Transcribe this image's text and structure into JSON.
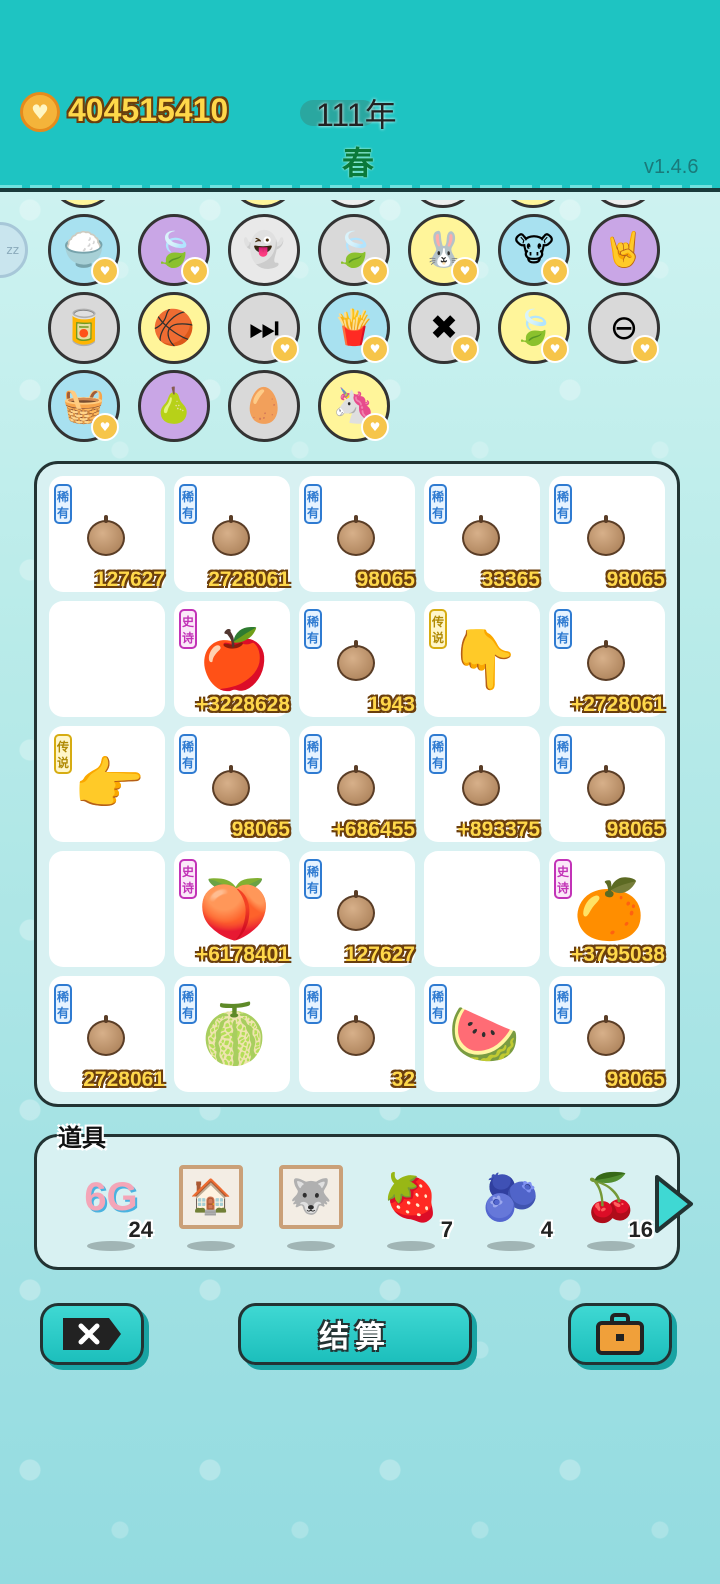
{
  "header": {
    "gold": "404515410",
    "year": "111年",
    "season": "春",
    "version": "v1.4.6",
    "side_button_label": "zz"
  },
  "symbols": [
    {
      "icon": "rice-bowl-icon",
      "glyph": "🍚",
      "bg": "#a8e1f0"
    },
    {
      "icon": "leaf-icon",
      "glyph": "🍃",
      "bg": "#c9a6e6"
    },
    {
      "icon": "ghost-icon",
      "glyph": "👻",
      "bg": "#e9e9e9"
    },
    {
      "icon": "leaf-icon",
      "glyph": "🍃",
      "bg": "#d9d9d9"
    },
    {
      "icon": "rabbit-icon",
      "glyph": "🐰",
      "bg": "#fff59a"
    },
    {
      "icon": "cows-icon",
      "glyph": "🐮",
      "bg": "#a8e1f0"
    },
    {
      "icon": "rock-hand-icon",
      "glyph": "🤘",
      "bg": "#c9a6e6"
    },
    {
      "icon": "dog-food-icon",
      "glyph": "🥫",
      "bg": "#d9d9d9"
    },
    {
      "icon": "basketballs-icon",
      "glyph": "🏀",
      "bg": "#fff59a"
    },
    {
      "icon": "skip-icon",
      "glyph": "⏭",
      "bg": "#d9d9d9"
    },
    {
      "icon": "fries-icon",
      "glyph": "🍟",
      "bg": "#a8e1f0"
    },
    {
      "icon": "remove-icon",
      "glyph": "✖",
      "bg": "#d9d9d9"
    },
    {
      "icon": "leaf-icon",
      "glyph": "🍃",
      "bg": "#fff59a"
    },
    {
      "icon": "minus-icon",
      "glyph": "⊖",
      "bg": "#d9d9d9"
    },
    {
      "icon": "fruit-basket-icon",
      "glyph": "🧺",
      "bg": "#a8e1f0"
    },
    {
      "icon": "pear-icon",
      "glyph": "🍐",
      "bg": "#c9a6e6"
    },
    {
      "icon": "egg-tray-icon",
      "glyph": "🥚",
      "bg": "#d9d9d9"
    },
    {
      "icon": "unicorn-icon",
      "glyph": "🦄",
      "bg": "#fff59a"
    }
  ],
  "board": [
    {
      "tag": "稀有",
      "tag_type": "rare",
      "icon": "nut",
      "value": "127627"
    },
    {
      "tag": "稀有",
      "tag_type": "rare",
      "icon": "nut",
      "value": "2728061"
    },
    {
      "tag": "稀有",
      "tag_type": "rare",
      "icon": "nut",
      "value": "98065"
    },
    {
      "tag": "稀有",
      "tag_type": "rare",
      "icon": "nut",
      "value": "33365"
    },
    {
      "tag": "稀有",
      "tag_type": "rare",
      "icon": "nut",
      "value": "98065"
    },
    {
      "tag": "",
      "tag_type": "",
      "icon": "",
      "value": ""
    },
    {
      "tag": "史诗",
      "tag_type": "epic",
      "icon": "🍎",
      "icon_name": "apple-icon",
      "value": "+3228628"
    },
    {
      "tag": "稀有",
      "tag_type": "rare",
      "icon": "nut",
      "value": "1943"
    },
    {
      "tag": "传说",
      "tag_type": "legend",
      "icon": "👇",
      "icon_name": "pointing-hand-icon",
      "value": ""
    },
    {
      "tag": "稀有",
      "tag_type": "rare",
      "icon": "nut",
      "value": "+2728061"
    },
    {
      "tag": "传说",
      "tag_type": "legend",
      "icon": "👉",
      "icon_name": "pointing-hand-icon",
      "value": ""
    },
    {
      "tag": "稀有",
      "tag_type": "rare",
      "icon": "nut",
      "value": "98065"
    },
    {
      "tag": "稀有",
      "tag_type": "rare",
      "icon": "nut",
      "value": "+686455"
    },
    {
      "tag": "稀有",
      "tag_type": "rare",
      "icon": "nut",
      "value": "+893375"
    },
    {
      "tag": "稀有",
      "tag_type": "rare",
      "icon": "nut",
      "value": "98065"
    },
    {
      "tag": "",
      "tag_type": "",
      "icon": "",
      "value": ""
    },
    {
      "tag": "史诗",
      "tag_type": "epic",
      "icon": "🍑",
      "icon_name": "peach-icon",
      "value": "+6178401"
    },
    {
      "tag": "稀有",
      "tag_type": "rare",
      "icon": "nut",
      "value": "127627"
    },
    {
      "tag": "",
      "tag_type": "",
      "icon": "",
      "value": ""
    },
    {
      "tag": "史诗",
      "tag_type": "epic",
      "icon": "🍊",
      "icon_name": "orange-icon",
      "value": "+3795038"
    },
    {
      "tag": "稀有",
      "tag_type": "rare",
      "icon": "nut",
      "value": "2728061"
    },
    {
      "tag": "稀有",
      "tag_type": "rare",
      "icon": "🍈",
      "icon_name": "lychee-icon",
      "value": ""
    },
    {
      "tag": "稀有",
      "tag_type": "rare",
      "icon": "nut",
      "value": "32"
    },
    {
      "tag": "稀有",
      "tag_type": "rare",
      "icon": "🍉",
      "icon_name": "watermelon-icon",
      "value": ""
    },
    {
      "tag": "稀有",
      "tag_type": "rare",
      "icon": "nut",
      "value": "98065"
    }
  ],
  "items": {
    "title": "道具",
    "list": [
      {
        "name": "6g-icon",
        "label": "6G",
        "count": "24"
      },
      {
        "name": "windmill-frame-icon",
        "glyph": "🏠",
        "count": ""
      },
      {
        "name": "husky-frame-icon",
        "glyph": "🐺",
        "count": ""
      },
      {
        "name": "strawberry-icon",
        "glyph": "🍓",
        "count": "7"
      },
      {
        "name": "blueberry-icon",
        "glyph": "🫐",
        "count": "4"
      },
      {
        "name": "bayberry-icon",
        "glyph": "🍒",
        "count": "16"
      }
    ]
  },
  "buttons": {
    "settle_label": "结算"
  }
}
